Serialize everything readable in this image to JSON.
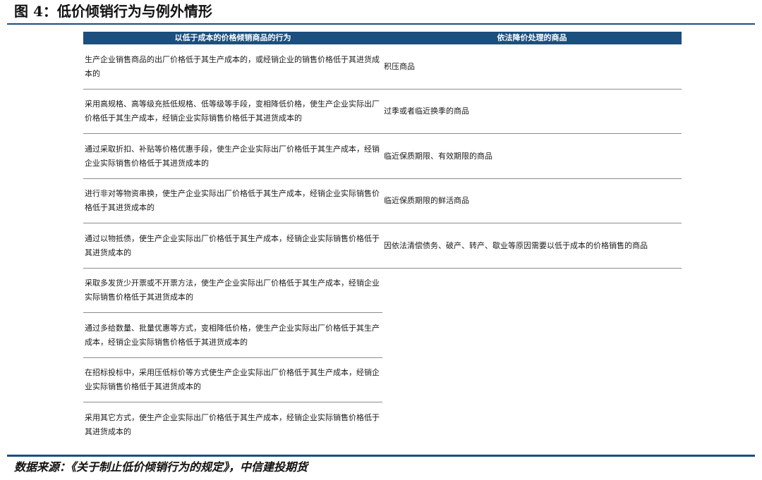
{
  "figure_title": "图 4：低价倾销行为与例外情形",
  "table": {
    "headers": [
      "以低于成本的价格倾销商品的行为",
      "依法降价处理的商品"
    ],
    "left_rows": [
      "生产企业销售商品的出厂价格低于其生产成本的，或经销企业的销售价格低于其进货成本的",
      "采用高规格、高等级充抵低规格、低等级等手段，变相降低价格，使生产企业实际出厂价格低于其生产成本，经销企业实际销售价格低于其进货成本的",
      "通过采取折扣、补贴等价格优惠手段，使生产企业实际出厂价格低于其生产成本，经销企业实际销售价格低于其进货成本的",
      "进行非对等物资串换，使生产企业实际出厂价格低于其生产成本，经销企业实际销售价格低于其进货成本的",
      "通过以物抵债，使生产企业实际出厂价格低于其生产成本，经销企业实际销售价格低于其进货成本的",
      "采取多发货少开票或不开票方法，使生产企业实际出厂价格低于其生产成本，经销企业实际销售价格低于其进货成本的",
      "通过多给数量、批量优惠等方式，变相降低价格，使生产企业实际出厂价格低于其生产成本，经销企业实际销售价格低于其进货成本的",
      "在招标投标中，采用压低标价等方式使生产企业实际出厂价格低于其生产成本，经销企业实际销售价格低于其进货成本的",
      "采用其它方式，使生产企业实际出厂价格低于其生产成本，经销企业实际销售价格低于其进货成本的"
    ],
    "right_rows": [
      "积压商品",
      "过季或者临近换季的商品",
      "临近保质期限、有效期限的商品",
      "临近保质期限的鲜活商品",
      "因依法清偿债务、破产、转产、歇业等原因需要以低于成本的价格销售的商品"
    ]
  },
  "source": "数据来源：《关于制止低价倾销行为的规定》，中信建投期货"
}
